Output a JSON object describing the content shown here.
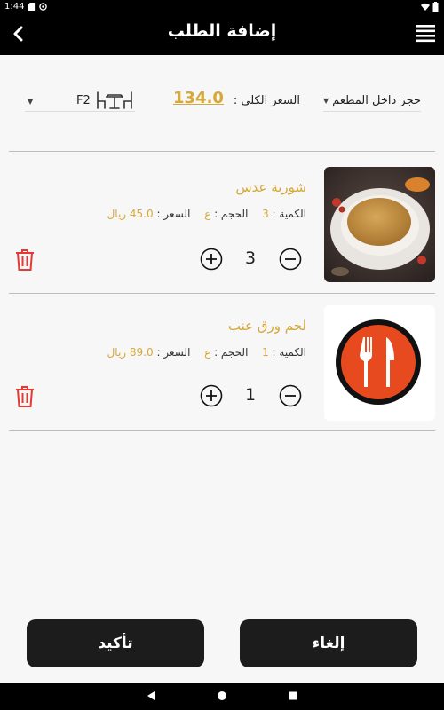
{
  "status_bar": {
    "time": "1:44"
  },
  "app_bar": {
    "title": "إضافة الطلب"
  },
  "summary": {
    "order_type": "حجز داخل المطعم",
    "total_label": "السعر الكلي :",
    "total_value": "134.0",
    "table_code": "F2"
  },
  "items": [
    {
      "name": "شوربة عدس",
      "quantity_label": "الكمية :",
      "quantity_value": "3",
      "size_label": "الحجم :",
      "size_value": "ع",
      "price_label": "السعر :",
      "price_value": "45.0 ريال",
      "qty": "3",
      "image": "lentil-soup-photo"
    },
    {
      "name": "لحم ورق عنب",
      "quantity_label": "الكمية :",
      "quantity_value": "1",
      "size_label": "الحجم :",
      "size_value": "ع",
      "price_label": "السعر :",
      "price_value": "89.0 ريال",
      "qty": "1",
      "image": "restaurant-logo"
    }
  ],
  "buttons": {
    "confirm": "تأكيد",
    "cancel": "إلغاء"
  },
  "colors": {
    "accent": "#d7a83a",
    "bar": "#000000",
    "button": "#1c1c1c",
    "delete": "#e53935"
  },
  "icons": [
    "back-arrow-icon",
    "menu-icon",
    "table-chairs-icon",
    "plus-circle-icon",
    "minus-circle-icon",
    "trash-icon",
    "nav-back-icon",
    "nav-home-icon",
    "nav-recents-icon"
  ]
}
